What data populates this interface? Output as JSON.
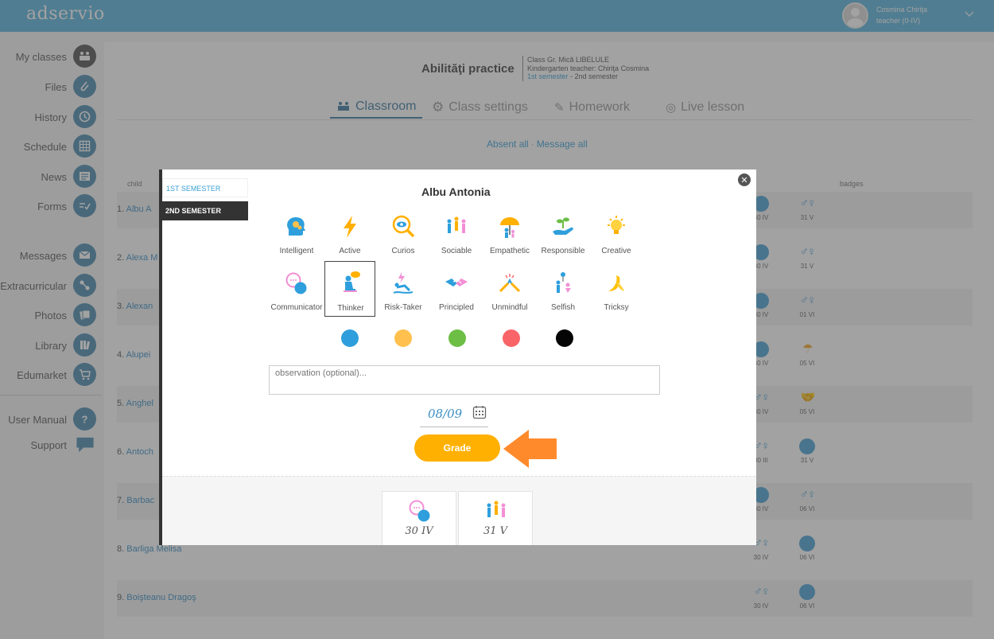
{
  "app": {
    "logo": "adservio"
  },
  "user": {
    "name": "Cosmina Chiriţa",
    "role": "teacher (0-IV)"
  },
  "sidebar": {
    "items": [
      {
        "label": "My classes",
        "icon": "classes-icon"
      },
      {
        "label": "Files",
        "icon": "paperclip-icon"
      },
      {
        "label": "History",
        "icon": "clock-icon"
      },
      {
        "label": "Schedule",
        "icon": "calendar-grid-icon"
      },
      {
        "label": "News",
        "icon": "news-icon"
      },
      {
        "label": "Forms",
        "icon": "forms-icon"
      },
      {
        "label": "Messages",
        "icon": "envelope-icon"
      },
      {
        "label": "Extracurricular",
        "icon": "extracurricular-icon"
      },
      {
        "label": "Photos",
        "icon": "photos-icon"
      },
      {
        "label": "Library",
        "icon": "books-icon"
      },
      {
        "label": "Edumarket",
        "icon": "cart-icon"
      },
      {
        "label": "User Manual",
        "icon": "question-icon"
      },
      {
        "label": "Support",
        "icon": "chat-bubble-icon"
      }
    ]
  },
  "page": {
    "title": "Abilităţi practice",
    "class_line": "Class Gr. Mică LIBELULE",
    "teacher_line": "Kindergarten teacher: Chiriţa Cosmina",
    "semester_1": "1st semester",
    "semester_sep": " - ",
    "semester_2": "2nd semester",
    "tabs": [
      "Classroom",
      "Class settings",
      "Homework",
      "Live lesson"
    ],
    "absent_all": "Absent all",
    "message_all": "Message all",
    "col_child": "child",
    "col_badges": "badges"
  },
  "students": [
    {
      "num": "1.",
      "name": "Albu A",
      "b1": "30 IV",
      "b2": "31 V"
    },
    {
      "num": "2.",
      "name": "Alexa M",
      "b1": "30 IV",
      "b2": "31 V"
    },
    {
      "num": "3.",
      "name": "Alexan",
      "b1": "30 IV",
      "b2": "01 VI"
    },
    {
      "num": "4.",
      "name": "Alupei",
      "b1": "30 IV",
      "b2": "05 VI"
    },
    {
      "num": "5.",
      "name": "Anghel",
      "b1": "30 IV",
      "b2": "05 VI"
    },
    {
      "num": "6.",
      "name": "Antoch",
      "b1": "30 III",
      "b2": "31 V"
    },
    {
      "num": "7.",
      "name": "Barbac",
      "b1": "30 IV",
      "b2": "06 VI"
    },
    {
      "num": "8.",
      "name": "Barliga Melisa",
      "b1": "30 IV",
      "b2": "06 VI"
    },
    {
      "num": "9.",
      "name": "Boişteanu Dragoş",
      "b1": "30 IV",
      "b2": "06 VI"
    }
  ],
  "modal": {
    "semester_tabs": [
      "1ST SEMESTER",
      "2ND SEMESTER"
    ],
    "student_name": "Albu Antonia",
    "traits_row1": [
      "Intelligent",
      "Active",
      "Curios",
      "Sociable",
      "Empathetic",
      "Responsible",
      "Creative"
    ],
    "traits_row2": [
      "Communicator",
      "Thinker",
      "Risk-Taker",
      "Principled",
      "Unmindful",
      "Selfish",
      "Tricksy"
    ],
    "selected_trait": "Thinker",
    "colors": [
      "#2e9fdc",
      "#ffc04d",
      "#6cbe45",
      "#f96468",
      "#050505"
    ],
    "observation_placeholder": "observation (optional)...",
    "date": "08/09",
    "grade_button": "Grade",
    "earned": [
      {
        "icon": "communicator-icon",
        "date": "30 IV"
      },
      {
        "icon": "sociable-icon",
        "date": "31 V"
      }
    ]
  }
}
